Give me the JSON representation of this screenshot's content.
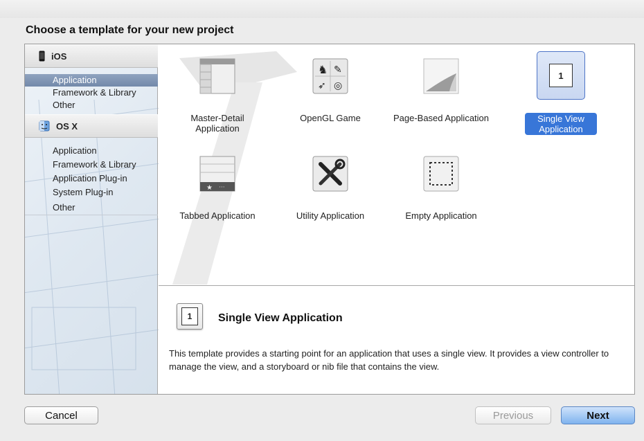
{
  "window": {
    "heading": "Choose a template for your new project"
  },
  "sidebar": {
    "groups": [
      {
        "title": "iOS",
        "icon": "iphone-icon",
        "items": [
          "Application",
          "Framework & Library",
          "Other"
        ],
        "selected_index": 0
      },
      {
        "title": "OS X",
        "icon": "finder-icon",
        "items": [
          "Application",
          "Framework & Library",
          "Application Plug-in",
          "System Plug-in",
          "Other"
        ]
      }
    ]
  },
  "templates": [
    {
      "label": "Master-Detail Application",
      "icon": "master-detail-icon",
      "selected": false
    },
    {
      "label": "OpenGL Game",
      "icon": "opengl-game-icon",
      "selected": false
    },
    {
      "label": "Page-Based Application",
      "icon": "page-curl-icon",
      "selected": false
    },
    {
      "label": "Single View Application",
      "icon": "single-view-icon",
      "selected": true
    },
    {
      "label": "Tabbed Application",
      "icon": "tabbed-icon",
      "selected": false
    },
    {
      "label": "Utility Application",
      "icon": "utility-tools-icon",
      "selected": false
    },
    {
      "label": "Empty Application",
      "icon": "empty-dashed-icon",
      "selected": false
    }
  ],
  "detail": {
    "icon_number": "1",
    "title": "Single View Application",
    "description": "This template provides a starting point for an application that uses a single view. It provides a view controller to manage the view, and a storyboard or nib file that contains the view."
  },
  "buttons": {
    "cancel": "Cancel",
    "previous": "Previous",
    "next": "Next"
  },
  "colors": {
    "selection_blue": "#3876d8",
    "sidebar_selection": "#7f94b3"
  }
}
